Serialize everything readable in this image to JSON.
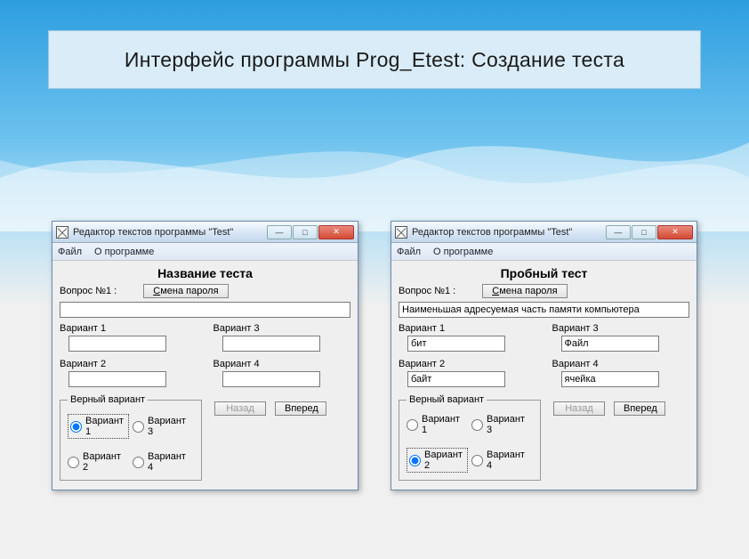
{
  "slide_title": "Интерфейс программы Prog_Etest: Создание теста",
  "left": {
    "titlebar": "Редактор текстов программы \"Test\"",
    "menu": {
      "file": "Файл",
      "about": "О программе"
    },
    "test_title": "Название теста",
    "question_label": "Вопрос №1 :",
    "change_pwd": "Смена пароля",
    "question_value": "",
    "variants": {
      "v1_label": "Вариант 1",
      "v1_value": "",
      "v2_label": "Вариант 2",
      "v2_value": "",
      "v3_label": "Вариант 3",
      "v3_value": "",
      "v4_label": "Вариант 4",
      "v4_value": ""
    },
    "correct_legend": "Верный вариант",
    "radios": {
      "r1": "Вариант 1",
      "r2": "Вариант 2",
      "r3": "Вариант 3",
      "r4": "Вариант 4"
    },
    "selected_radio": "r1",
    "nav": {
      "back": "Назад",
      "forward": "Вперед"
    }
  },
  "right": {
    "titlebar": "Редактор текстов программы \"Test\"",
    "menu": {
      "file": "Файл",
      "about": "О программе"
    },
    "test_title": "Пробный тест",
    "question_label": "Вопрос №1 :",
    "change_pwd": "Смена пароля",
    "question_value": "Наименьшая адресуемая часть памяти компьютера",
    "variants": {
      "v1_label": "Вариант 1",
      "v1_value": "бит",
      "v2_label": "Вариант 2",
      "v2_value": "байт",
      "v3_label": "Вариант 3",
      "v3_value": "Файл",
      "v4_label": "Вариант 4",
      "v4_value": "ячейка"
    },
    "correct_legend": "Верный вариант",
    "radios": {
      "r1": "Вариант 1",
      "r2": "Вариант 2",
      "r3": "Вариант 3",
      "r4": "Вариант 4"
    },
    "selected_radio": "r2",
    "nav": {
      "back": "Назад",
      "forward": "Вперед"
    }
  },
  "winbtns": {
    "min": "—",
    "max": "□",
    "close": "✕"
  }
}
